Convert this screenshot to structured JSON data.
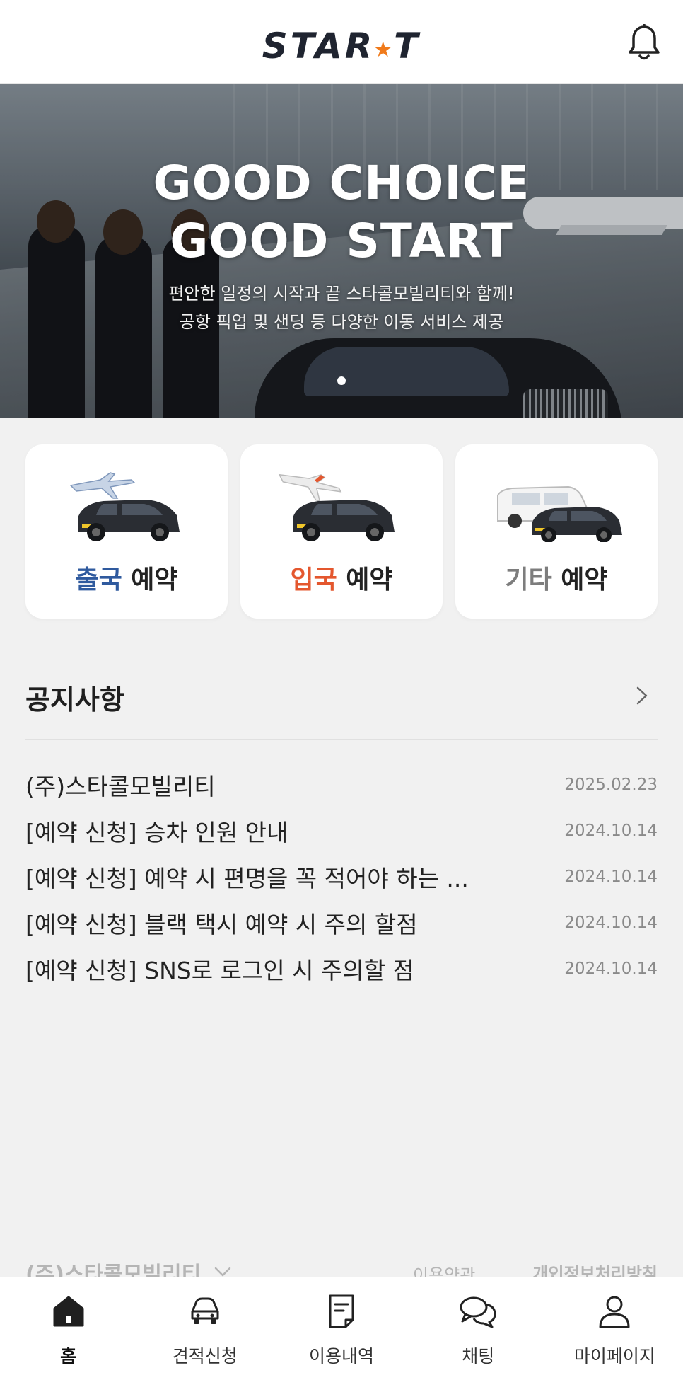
{
  "header": {
    "logo_left": "STAR",
    "logo_right": "T",
    "logo_star": "★",
    "bell_icon": "bell-icon"
  },
  "hero": {
    "title_line1": "GOOD CHOICE",
    "title_line2": "GOOD START",
    "subtitle_line1": "편안한 일정의 시작과 끝 스타콜모빌리티와 함께!",
    "subtitle_line2": "공항 픽업 및 샌딩 등 다양한 이동 서비스 제공",
    "carousel_total": 1,
    "carousel_active": 1
  },
  "reservations": [
    {
      "accent": "출국",
      "rest": " 예약",
      "accent_color": "#2f5a9e",
      "icon": "departure-car-icon"
    },
    {
      "accent": "입국",
      "rest": " 예약",
      "accent_color": "#e4572e",
      "icon": "arrival-car-icon"
    },
    {
      "accent": "기타",
      "rest": " 예약",
      "accent_color": "#7d7d7d",
      "icon": "other-vehicles-icon"
    }
  ],
  "notices": {
    "title": "공지사항",
    "items": [
      {
        "text": "(주)스타콜모빌리티",
        "date": "2025.02.23"
      },
      {
        "text": "[예약 신청] 승차 인원 안내",
        "date": "2024.10.14"
      },
      {
        "text": "[예약 신청] 예약 시 편명을 꼭 적어야 하는 ...",
        "date": "2024.10.14"
      },
      {
        "text": "[예약 신청] 블랙 택시 예약 시 주의 할점",
        "date": "2024.10.14"
      },
      {
        "text": "[예약 신청] SNS로 로그인 시 주의할 점",
        "date": "2024.10.14"
      }
    ]
  },
  "footer": {
    "company": "(주)스타콜모빌리티",
    "terms": "이용약관",
    "privacy": "개인정보처리방침"
  },
  "bottom_nav": [
    {
      "label": "홈",
      "icon": "home-icon",
      "active": true
    },
    {
      "label": "견적신청",
      "icon": "car-icon",
      "active": false
    },
    {
      "label": "이용내역",
      "icon": "document-icon",
      "active": false
    },
    {
      "label": "채팅",
      "icon": "chat-icon",
      "active": false
    },
    {
      "label": "마이페이지",
      "icon": "user-icon",
      "active": false
    }
  ]
}
